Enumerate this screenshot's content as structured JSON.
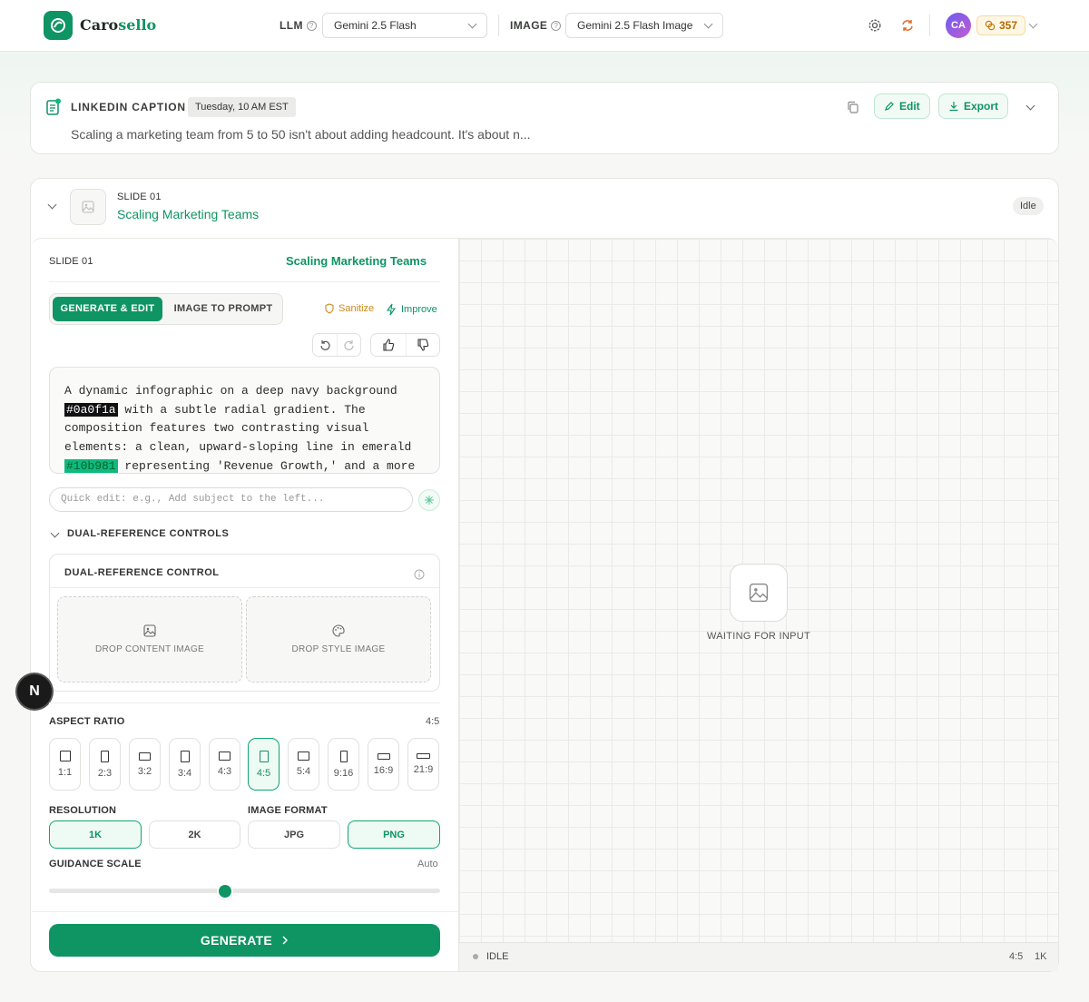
{
  "app": {
    "name_prefix": "Caro",
    "name_suffix": "sello",
    "brand_color": "#0f9463"
  },
  "toolbar": {
    "llm_label": "LLM",
    "llm_value": "Gemini 2.5 Flash",
    "image_label": "IMAGE",
    "image_value": "Gemini 2.5 Flash Image",
    "avatar_initials": "CA",
    "credits": "357"
  },
  "caption": {
    "title": "LINKEDIN CAPTION",
    "schedule": "Tuesday, 10 AM EST",
    "text": "Scaling a marketing team from 5 to 50 isn't about adding headcount. It's about n...",
    "edit_label": "Edit",
    "export_label": "Export"
  },
  "slide": {
    "number_label": "SLIDE 01",
    "title": "Scaling Marketing Teams",
    "status": "Idle"
  },
  "editor": {
    "slide_label": "SLIDE 01",
    "slide_title": "Scaling Marketing Teams",
    "tabs": [
      "GENERATE & EDIT",
      "IMAGE TO PROMPT"
    ],
    "sanitize_label": "Sanitize",
    "improve_label": "Improve",
    "prompt": {
      "p1": "A dynamic infographic on a deep navy background ",
      "hex1": "#0a0f1a",
      "p2": " with a subtle radial gradient. The composition features two contrasting visual elements: a clean, upward-sloping line in emerald ",
      "hex2": "#10b981",
      "p3": " representing 'Revenue Growth,' and a more"
    },
    "quick_edit_placeholder": "Quick edit: e.g., Add subject to the left...",
    "dual_ref_toggle": "DUAL-REFERENCE CONTROLS",
    "dual_ref_title": "DUAL-REFERENCE CONTROL",
    "drop_content": "DROP CONTENT IMAGE",
    "drop_style": "DROP STYLE IMAGE",
    "aspect_label": "ASPECT RATIO",
    "aspect_value": "4:5",
    "ratios": [
      "1:1",
      "2:3",
      "3:2",
      "3:4",
      "4:3",
      "4:5",
      "5:4",
      "9:16",
      "16:9",
      "21:9"
    ],
    "resolution_label": "RESOLUTION",
    "resolutions": [
      "1K",
      "2K"
    ],
    "format_label": "IMAGE FORMAT",
    "formats": [
      "JPG",
      "PNG"
    ],
    "guidance_label": "GUIDANCE SCALE",
    "guidance_value": "Auto",
    "guidance_level": 0.45,
    "generate_label": "GENERATE"
  },
  "canvas": {
    "waiting": "WAITING FOR INPUT",
    "footer_status": "IDLE",
    "footer_ratio": "4:5",
    "footer_res": "1K"
  },
  "misc": {
    "n_badge": "N"
  }
}
